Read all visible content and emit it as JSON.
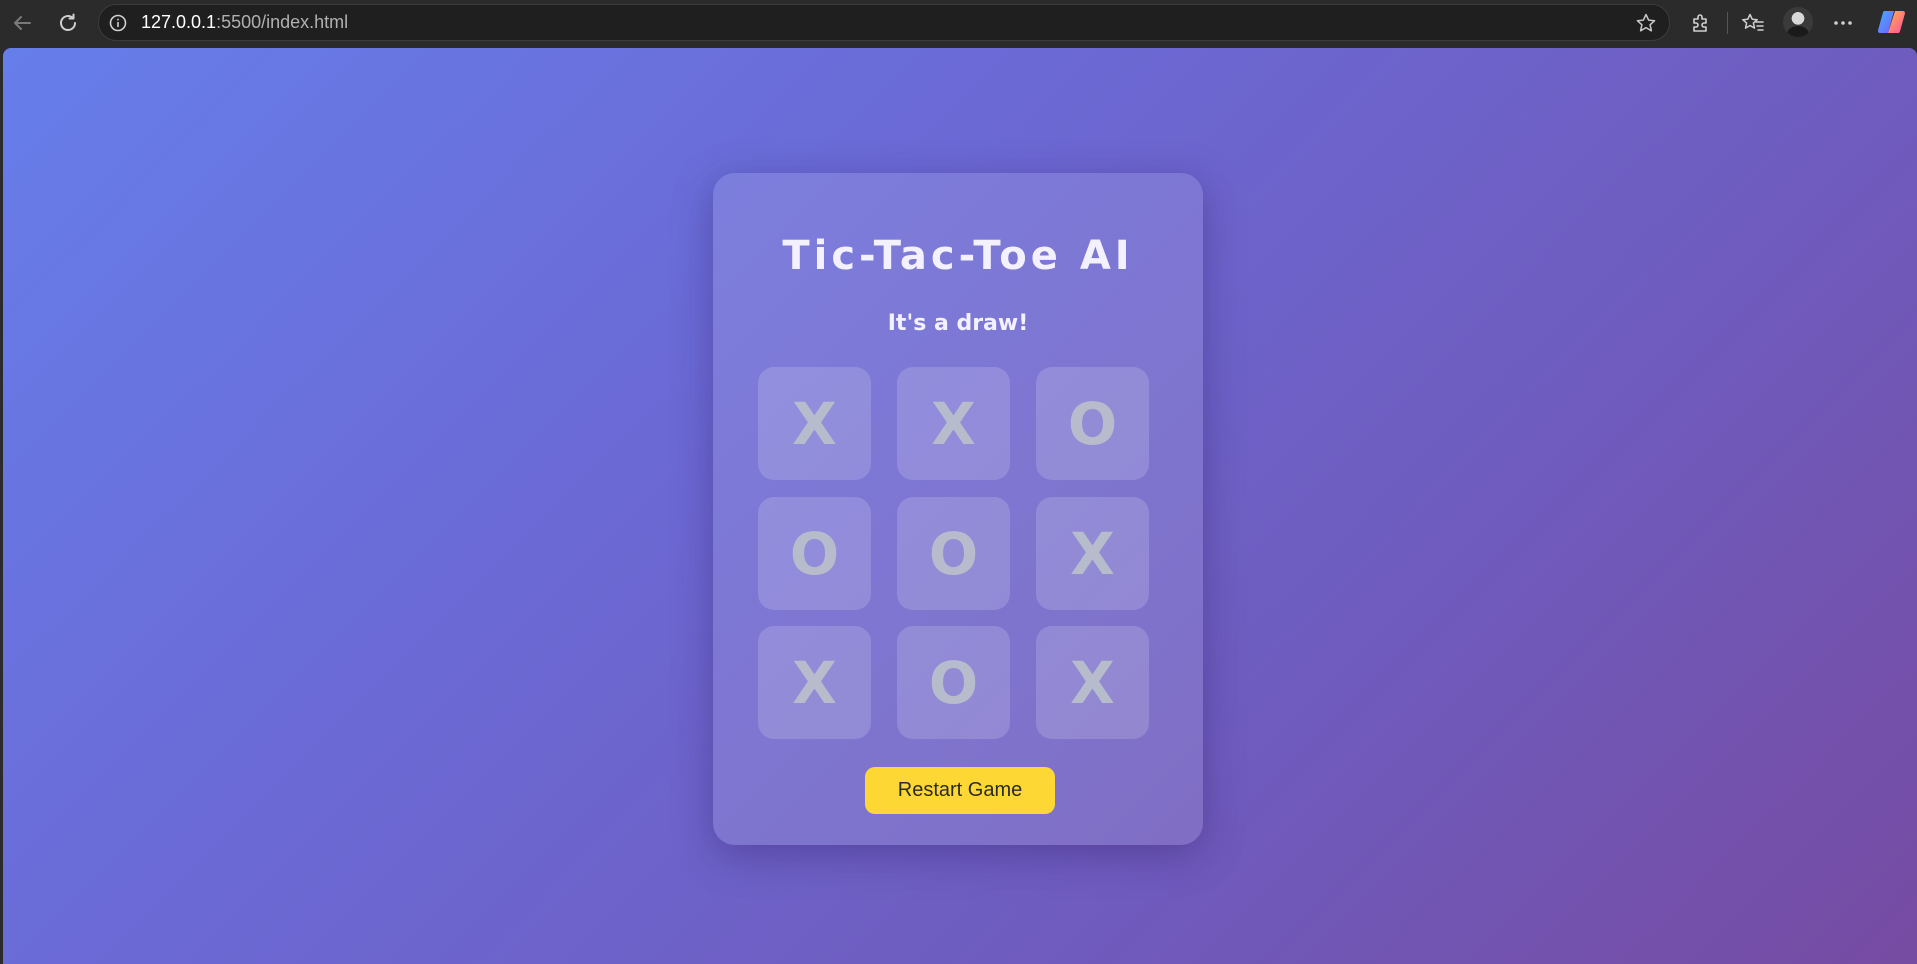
{
  "browser": {
    "url_host": "127.0.0.1",
    "url_rest": ":5500/index.html",
    "icons": {
      "back": "back-arrow-icon",
      "reload": "reload-icon",
      "site_info": "info-icon",
      "favorite": "star-icon",
      "extensions": "puzzle-icon",
      "favorites": "favorites-icon",
      "profile": "avatar",
      "more": "more-icon",
      "copilot": "copilot-icon"
    }
  },
  "page": {
    "background_gradient": [
      "#667eea",
      "#764ba2"
    ],
    "title": "Tic-Tac-Toe AI",
    "status": "It's a draw!",
    "board": [
      [
        "X",
        "X",
        "O"
      ],
      [
        "O",
        "O",
        "X"
      ],
      [
        "X",
        "O",
        "X"
      ]
    ],
    "restart_label": "Restart Game",
    "accent_color": "#fdd835",
    "mark_color": "#b6bccb"
  }
}
